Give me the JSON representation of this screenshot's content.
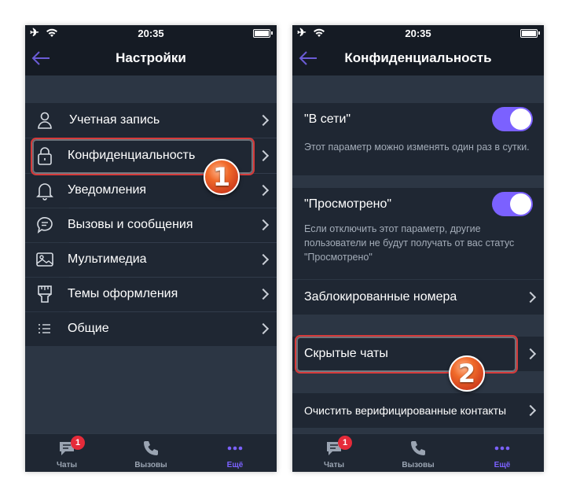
{
  "status": {
    "time": "20:35"
  },
  "left": {
    "title": "Настройки",
    "items": [
      {
        "label": "Учетная запись",
        "icon": "user-icon"
      },
      {
        "label": "Конфиденциальность",
        "icon": "lock-icon"
      },
      {
        "label": "Уведомления",
        "icon": "bell-icon"
      },
      {
        "label": "Вызовы и сообщения",
        "icon": "message-icon"
      },
      {
        "label": "Мультимедиа",
        "icon": "image-icon"
      },
      {
        "label": "Темы оформления",
        "icon": "brush-icon"
      },
      {
        "label": "Общие",
        "icon": "list-icon"
      }
    ],
    "step": "1"
  },
  "right": {
    "title": "Конфиденциальность",
    "online_label": "\"В сети\"",
    "online_desc": "Этот параметр можно изменять один раз в сутки.",
    "seen_label": "\"Просмотрено\"",
    "seen_desc": "Если отключить этот параметр, другие пользователи не будут получать от вас статус \"Просмотрено\"",
    "blocked_label": "Заблокированные номера",
    "hidden_label": "Скрытые чаты",
    "clear_label": "Очистить верифицированные контакты",
    "step": "2"
  },
  "tabs": [
    {
      "label": "Чаты",
      "badge": "1"
    },
    {
      "label": "Вызовы"
    },
    {
      "label": "Ещё"
    }
  ],
  "colors": {
    "accent": "#7b61ff",
    "background": "#2c3644",
    "row": "#1f2733",
    "bar": "#151b24",
    "badge": "#e52b3a",
    "highlight": "#d63a3a"
  }
}
